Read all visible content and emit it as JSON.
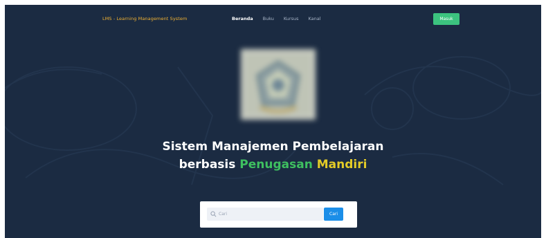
{
  "navbar": {
    "brand": "LMS - Learning Management System",
    "links": [
      {
        "label": "Beranda",
        "active": true
      },
      {
        "label": "Buku",
        "active": false
      },
      {
        "label": "Kursus",
        "active": false
      },
      {
        "label": "Kanal",
        "active": false
      }
    ],
    "login_label": "Masuk"
  },
  "hero": {
    "line1": "Sistem Manajemen Pembelajaran",
    "line2_prefix": "berbasis",
    "line2_green": "Penugasan",
    "line2_yellow": "Mandiri"
  },
  "search": {
    "placeholder": "Cari",
    "button_label": "Cari"
  },
  "colors": {
    "background": "#1b2b42",
    "brand": "#f3b332",
    "login": "#3cc37f",
    "green_accent": "#3ec060",
    "yellow_accent": "#e3cb27",
    "search_button": "#1b8ee8"
  }
}
